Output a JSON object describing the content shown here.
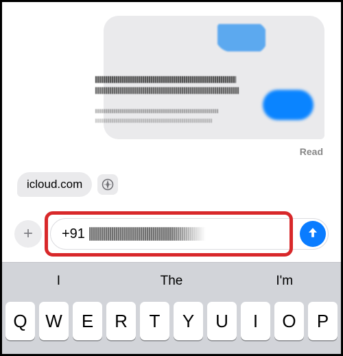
{
  "message": {
    "read_status": "Read"
  },
  "link_preview": {
    "domain": "icloud.com"
  },
  "compose": {
    "input_value": "+91",
    "plus_glyph": "+"
  },
  "keyboard": {
    "suggestions": [
      "I",
      "The",
      "I'm"
    ],
    "row1": [
      "Q",
      "W",
      "E",
      "R",
      "T",
      "Y",
      "U",
      "I",
      "O",
      "P"
    ]
  }
}
